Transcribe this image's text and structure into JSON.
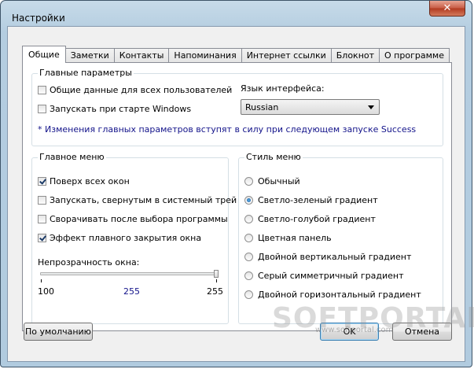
{
  "window": {
    "title": "Настройки",
    "close_glyph": "✕"
  },
  "tabs": [
    {
      "label": "Общие",
      "active": true
    },
    {
      "label": "Заметки"
    },
    {
      "label": "Контакты"
    },
    {
      "label": "Напоминания"
    },
    {
      "label": "Интернет ссылки"
    },
    {
      "label": "Блокнот"
    },
    {
      "label": "О программе"
    }
  ],
  "main_params": {
    "title": "Главные параметры",
    "shared_data": {
      "label": "Общие данные для всех пользователей",
      "checked": false
    },
    "run_on_startup": {
      "label": "Запускать при старте Windows",
      "checked": false
    },
    "language_label": "Язык интерфейса:",
    "language_value": "Russian",
    "note": "* Изменения главных параметров вступят в силу при следующем запуске Success"
  },
  "main_menu": {
    "title": "Главное меню",
    "items": [
      {
        "label": "Поверх всех окон",
        "checked": true
      },
      {
        "label": "Запускать, свернутым в системный трей",
        "checked": false
      },
      {
        "label": "Сворачивать после выбора программы",
        "checked": false
      },
      {
        "label": "Эффект плавного закрытия окна",
        "checked": true
      }
    ],
    "opacity_label": "Непрозрачность окна:",
    "opacity_min": "100",
    "opacity_current": "255",
    "opacity_max": "255"
  },
  "menu_style": {
    "title": "Стиль меню",
    "options": [
      {
        "label": "Обычный",
        "selected": false
      },
      {
        "label": "Светло-зеленый градиент",
        "selected": true
      },
      {
        "label": "Светло-голубой градиент",
        "selected": false
      },
      {
        "label": "Цветная панель",
        "selected": false
      },
      {
        "label": "Двойной вертикальный градиент",
        "selected": false
      },
      {
        "label": "Серый симметричный градиент",
        "selected": false
      },
      {
        "label": "Двойной горизонтальный градиент",
        "selected": false
      }
    ]
  },
  "buttons": {
    "defaults": "По умолчанию",
    "ok": "OK",
    "cancel": "Отмена"
  },
  "watermark": {
    "text": "SOFTPORTAL",
    "sub": "www.softportal.com"
  }
}
